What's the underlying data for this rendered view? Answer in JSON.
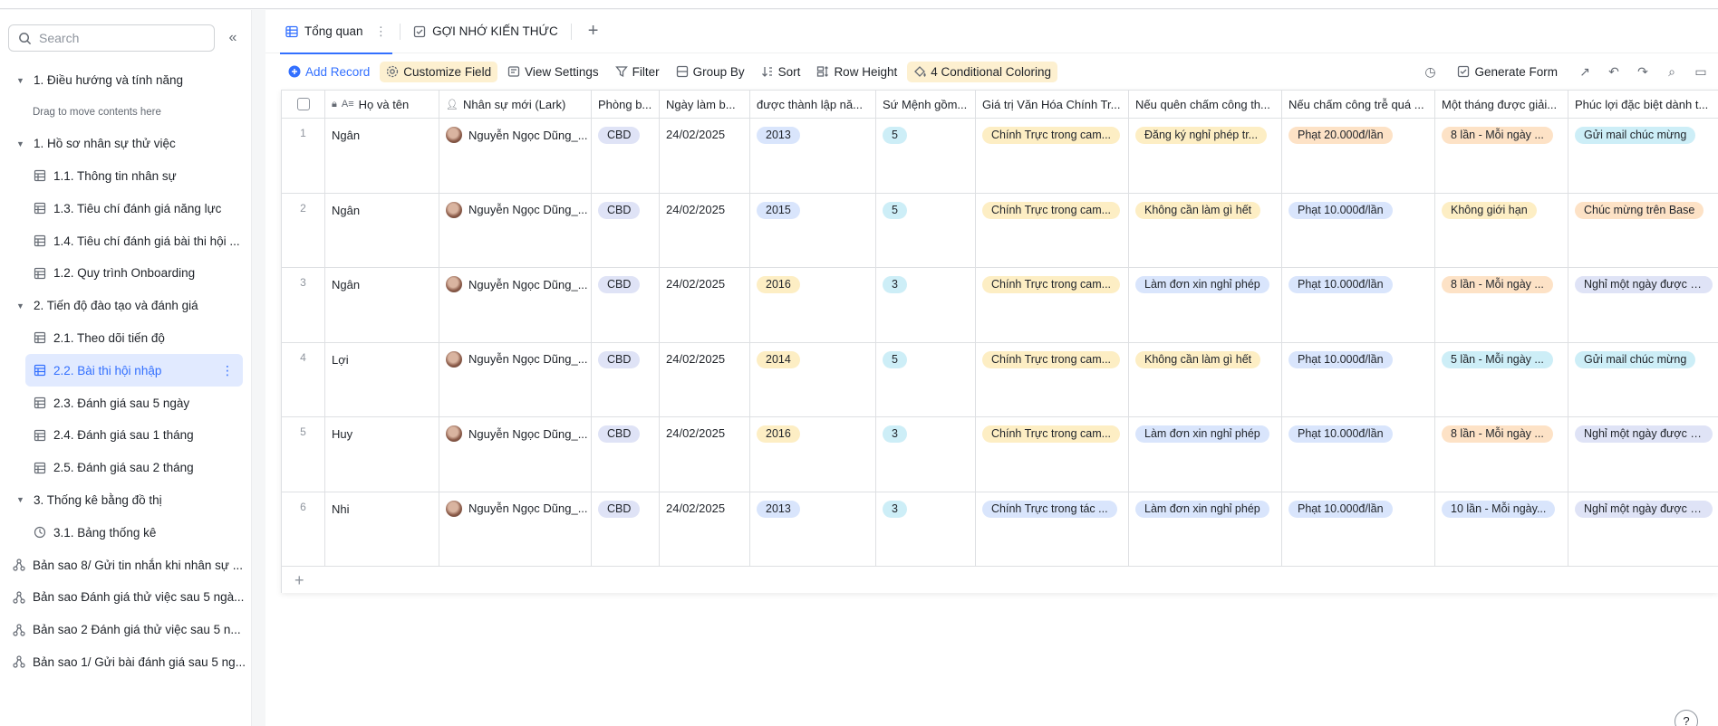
{
  "sidebar": {
    "search_placeholder": "Search",
    "items": [
      {
        "type": "group",
        "label": "1. Điều hướng và tính năng"
      },
      {
        "type": "hint",
        "label": "Drag to move contents here"
      },
      {
        "type": "group",
        "label": "1. Hồ sơ nhân sự thử việc"
      },
      {
        "type": "table",
        "label": "1.1. Thông tin nhân sự"
      },
      {
        "type": "table",
        "label": "1.3. Tiêu chí đánh giá năng lực"
      },
      {
        "type": "table",
        "label": "1.4. Tiêu chí đánh giá bài thi hội ..."
      },
      {
        "type": "table",
        "label": "1.2. Quy trình Onboarding"
      },
      {
        "type": "group",
        "label": "2. Tiến độ đào tạo và đánh giá"
      },
      {
        "type": "table",
        "label": "2.1. Theo dõi tiến độ"
      },
      {
        "type": "table-active",
        "label": "2.2. Bài thi hội nhập"
      },
      {
        "type": "table",
        "label": "2.3. Đánh giá sau 5 ngày"
      },
      {
        "type": "table",
        "label": "2.4. Đánh giá sau 1 tháng"
      },
      {
        "type": "table",
        "label": "2.5. Đánh giá sau 2 tháng"
      },
      {
        "type": "group",
        "label": "3. Thống kê bằng đồ thị"
      },
      {
        "type": "dashboard",
        "label": "3.1. Bảng thống kê"
      },
      {
        "type": "workflow",
        "label": "Bản sao 8/ Gửi tin nhắn khi nhân sự ..."
      },
      {
        "type": "workflow",
        "label": "Bản sao Đánh giá thử việc sau 5 ngà..."
      },
      {
        "type": "workflow",
        "label": "Bản sao 2 Đánh giá thử việc sau 5 n..."
      },
      {
        "type": "workflow",
        "label": "Bản sao 1/ Gửi bài đánh giá sau 5 ng..."
      }
    ]
  },
  "tabs": [
    {
      "label": "Tổng quan",
      "active": true
    },
    {
      "label": "GỢI NHỚ KIẾN THỨC",
      "active": false
    }
  ],
  "toolbar": {
    "add_record": "Add Record",
    "customize_field": "Customize Field",
    "view_settings": "View Settings",
    "filter": "Filter",
    "group_by": "Group By",
    "sort": "Sort",
    "row_height": "Row Height",
    "conditional_coloring": "4 Conditional Coloring",
    "generate_form": "Generate Form"
  },
  "columns": [
    "Họ và tên",
    "Nhân sự mới (Lark)",
    "Phòng b...",
    "Ngày làm b...",
    "được thành lập nă...",
    "Sứ Mệnh gồm...",
    "Giá trị Văn Hóa Chính Tr...",
    "Nếu quên chấm công th...",
    "Nếu chấm công trễ quá ...",
    "Một tháng được giải...",
    "Phúc lợi đặc biệt  dành t..."
  ],
  "rows": [
    {
      "num": "1",
      "name": "Ngân",
      "person": "Nguyễn Ngọc Dũng_...",
      "dept": "CBD",
      "date": "24/02/2025",
      "year": "2013",
      "mission": "5",
      "value": "Chính Trực trong cam...",
      "forgot": "Đăng ký nghỉ phép tr...",
      "late": "Phạt 20.000đ/lần",
      "month": "8 lần - Mỗi ngày ...",
      "benefit": "Gửi mail chúc mừng"
    },
    {
      "num": "2",
      "name": "Ngân",
      "person": "Nguyễn Ngọc Dũng_...",
      "dept": "CBD",
      "date": "24/02/2025",
      "year": "2015",
      "mission": "5",
      "value": "Chính Trực trong cam...",
      "forgot": "Không cần làm gì hết",
      "late": "Phạt 10.000đ/lần",
      "month": "Không giới hạn",
      "benefit": "Chúc mừng trên Base"
    },
    {
      "num": "3",
      "name": "Ngân",
      "person": "Nguyễn Ngọc Dũng_...",
      "dept": "CBD",
      "date": "24/02/2025",
      "year": "2016",
      "mission": "3",
      "value": "Chính Trực trong cam...",
      "forgot": "Làm đơn xin nghỉ phép",
      "late": "Phạt 10.000đ/lần",
      "month": "8 lần - Mỗi ngày ...",
      "benefit": "Nghỉ một ngày được h..."
    },
    {
      "num": "4",
      "name": "Lợi",
      "person": "Nguyễn Ngọc Dũng_...",
      "dept": "CBD",
      "date": "24/02/2025",
      "year": "2014",
      "mission": "5",
      "value": "Chính Trực trong cam...",
      "forgot": "Không cần làm gì hết",
      "late": "Phạt 10.000đ/lần",
      "month": "5 lần - Mỗi ngày ...",
      "benefit": "Gửi mail chúc mừng"
    },
    {
      "num": "5",
      "name": "Huy",
      "person": "Nguyễn Ngọc Dũng_...",
      "dept": "CBD",
      "date": "24/02/2025",
      "year": "2016",
      "mission": "3",
      "value": "Chính Trực trong cam...",
      "forgot": "Làm đơn xin nghỉ phép",
      "late": "Phạt 10.000đ/lần",
      "month": "8 lần - Mỗi ngày ...",
      "benefit": "Nghỉ một ngày được h..."
    },
    {
      "num": "6",
      "name": "Nhi",
      "person": "Nguyễn Ngọc Dũng_...",
      "dept": "CBD",
      "date": "24/02/2025",
      "year": "2013",
      "mission": "3",
      "value": "Chính Trực trong tác ...",
      "forgot": "Làm đơn xin nghỉ phép",
      "late": "Phạt 10.000đ/lần",
      "month": "10 lần - Mỗi ngày...",
      "benefit": "Nghỉ một ngày được h..."
    }
  ],
  "tag_colors": {
    "year": {
      "2013": "blue",
      "2015": "blue",
      "2016": "yellow",
      "2014": "yellow"
    },
    "value": {
      "Chính Trực trong cam...": "yellow",
      "Chính Trực trong tác ...": "blue"
    },
    "forgot": {
      "Đăng ký nghỉ phép tr...": "yellow",
      "Không cần làm gì hết": "yellow",
      "Làm đơn xin nghỉ phép": "blue"
    },
    "late": {
      "Phạt 20.000đ/lần": "orange",
      "Phạt 10.000đ/lần": "blue"
    },
    "month": {
      "8 lần - Mỗi ngày ...": "orange",
      "Không giới hạn": "yellow",
      "5 lần - Mỗi ngày ...": "cyan",
      "10 lần - Mỗi ngày...": "blue"
    },
    "benefit": {
      "Gửi mail chúc mừng": "cyan",
      "Chúc mừng trên Base": "orange",
      "Nghỉ một ngày được h...": "lav"
    }
  },
  "help_label": "?"
}
